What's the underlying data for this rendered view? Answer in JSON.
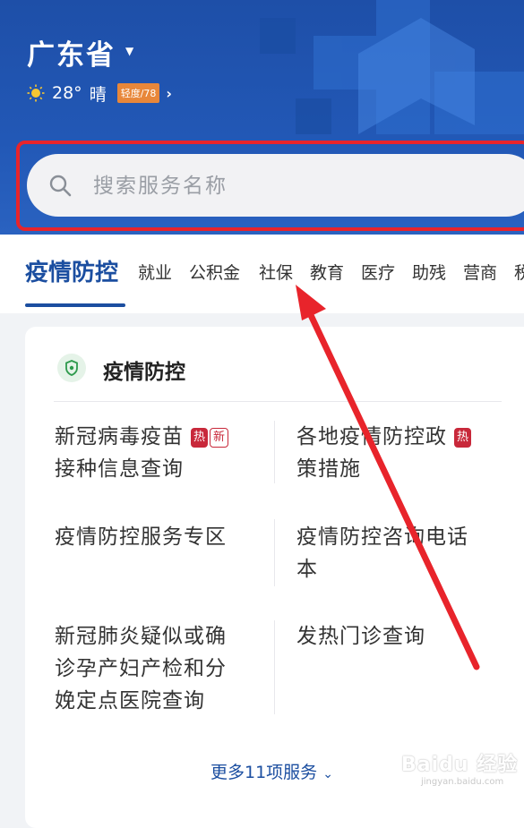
{
  "header": {
    "province": "广东省",
    "weather": {
      "temperature": "28°",
      "condition": "晴",
      "aqi_badge": "轻度/78"
    }
  },
  "search": {
    "placeholder": "搜索服务名称"
  },
  "tabs": [
    {
      "label": "疫情防控",
      "active": true
    },
    {
      "label": "就业"
    },
    {
      "label": "公积金"
    },
    {
      "label": "社保"
    },
    {
      "label": "教育"
    },
    {
      "label": "医疗"
    },
    {
      "label": "助残"
    },
    {
      "label": "营商"
    },
    {
      "label": "税"
    }
  ],
  "card": {
    "title": "疫情防控",
    "services": [
      {
        "name_line1": "新冠病毒疫苗",
        "name_line2": "接种信息查询",
        "badges": [
          "热",
          "新"
        ]
      },
      {
        "name_line1": "各地疫情防控政",
        "name_line2": "策措施",
        "badges": [
          "热"
        ]
      },
      {
        "name_line1": "疫情防控服务专区"
      },
      {
        "name_line1": "疫情防控咨询电话",
        "name_line2": "本"
      },
      {
        "name_line1": "新冠肺炎疑似或确",
        "name_line2": "诊孕产妇产检和分",
        "name_line3": "娩定点医院查询"
      },
      {
        "name_line1": "发热门诊查询"
      }
    ],
    "more_label": "更多11项服务"
  },
  "watermark": {
    "text": "Baidu 经验",
    "sub": "jingyan.baidu.com"
  },
  "colors": {
    "header_blue": "#2258b6",
    "accent_blue": "#1b4ea0",
    "highlight_red": "#e8242b",
    "badge_red": "#c8283a",
    "aqi_orange": "#e8873a"
  },
  "icons": [
    "chevron-down-icon",
    "sun-icon",
    "chevron-right-icon",
    "search-icon",
    "shield-icon"
  ]
}
